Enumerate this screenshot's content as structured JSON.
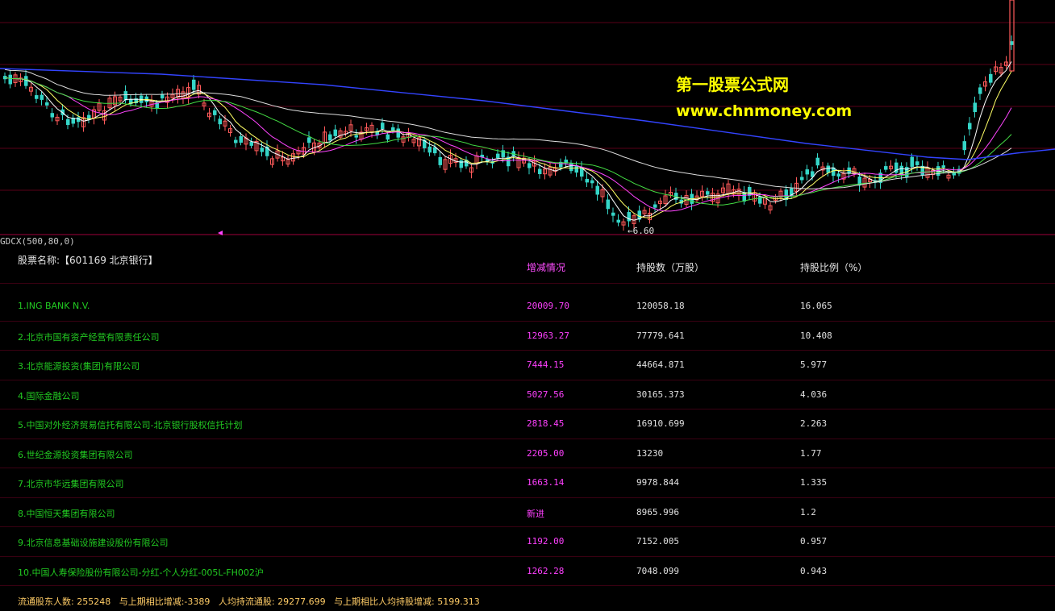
{
  "watermark": {
    "title": "第一股票公式网",
    "url": "www.chnmoney.com"
  },
  "chart": {
    "indicator_label": "GDCX(500,80,0)",
    "low_marker": "←6.60",
    "colors": {
      "background": "#000000",
      "up_candle": "#ff5a5a",
      "down_candle": "#35d6c8",
      "ma_white": "#ffffff",
      "ma_yellow": "#ffff66",
      "ma_magenta": "#ff44ff",
      "ma_green": "#44dd44",
      "ma_blue": "#3344ff",
      "grid": "#5a0018"
    }
  },
  "table": {
    "stock_label": "股票名称:【601169 北京银行】",
    "headers": {
      "change": "增减情况",
      "shares": "持股数（万股）",
      "ratio": "持股比例（%）"
    },
    "rows": [
      {
        "name": "1.ING BANK N.V.",
        "change": "20009.70",
        "shares": "120058.18",
        "ratio": "16.065"
      },
      {
        "name": "2.北京市国有资产经营有限责任公司",
        "change": "12963.27",
        "shares": "77779.641",
        "ratio": "10.408"
      },
      {
        "name": "3.北京能源投资(集团)有限公司",
        "change": "7444.15",
        "shares": "44664.871",
        "ratio": "5.977"
      },
      {
        "name": "4.国际金融公司",
        "change": "5027.56",
        "shares": "30165.373",
        "ratio": "4.036"
      },
      {
        "name": "5.中国对外经济贸易信托有限公司-北京银行股权信托计划",
        "change": "2818.45",
        "shares": "16910.699",
        "ratio": "2.263"
      },
      {
        "name": "6.世纪金源投资集团有限公司",
        "change": "2205.00",
        "shares": "13230",
        "ratio": "1.77"
      },
      {
        "name": "7.北京市华远集团有限公司",
        "change": "1663.14",
        "shares": "9978.844",
        "ratio": "1.335"
      },
      {
        "name": "8.中国恒天集团有限公司",
        "change": "新进",
        "shares": "8965.996",
        "ratio": "1.2"
      },
      {
        "name": "9.北京信息基础设施建设股份有限公司",
        "change": "1192.00",
        "shares": "7152.005",
        "ratio": "0.957"
      },
      {
        "name": "10.中国人寿保险股份有限公司-分红-个人分红-005L-FH002沪",
        "change": "1262.28",
        "shares": "7048.099",
        "ratio": "0.943"
      }
    ]
  },
  "footer": {
    "holders": "流通股东人数: 255248",
    "holders_change": "与上期相比增减:-3389",
    "avg_float": "人均持流通股: 29277.699",
    "avg_change": "与上期相比人均持股增减: 5199.313"
  }
}
